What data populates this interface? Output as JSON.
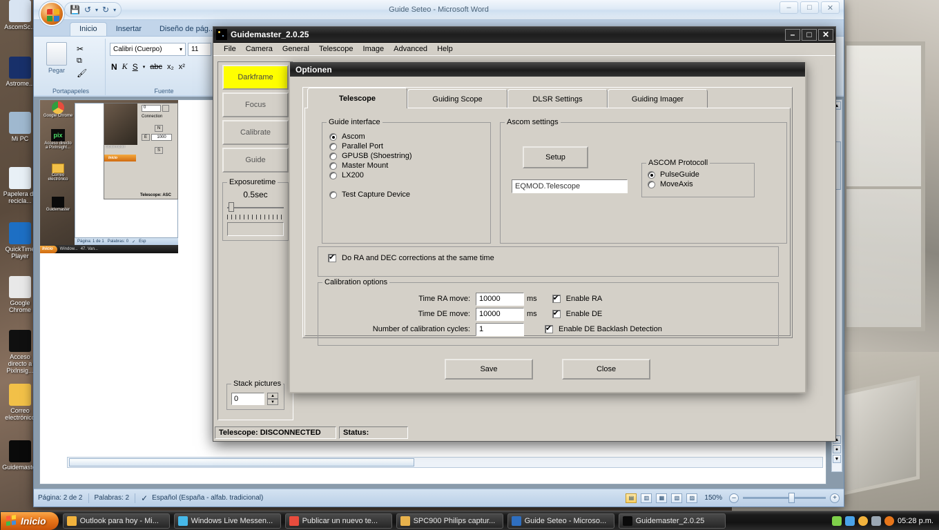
{
  "desktop": {
    "icons": [
      {
        "label": "AscomSc...",
        "color": "#d8e4f2"
      },
      {
        "label": "Astrome...",
        "color": "#18306a"
      },
      {
        "label": "Mi PC",
        "color": "#9fb8cf"
      },
      {
        "label": "Papelera de recicla...",
        "color": "#e8f0f6"
      },
      {
        "label": "QuickTime Player",
        "color": "#1d6fc4"
      },
      {
        "label": "Google Chrome",
        "color": "#e8e8e8"
      },
      {
        "label": "Acceso directo a PixInsig...",
        "color": "#101010"
      },
      {
        "label": "Correo electrónico",
        "color": "#f2c048"
      },
      {
        "label": "Guidemaster",
        "color": "#0a0a0a"
      }
    ]
  },
  "word": {
    "title": "Guide Seteo - Microsoft Word",
    "window_controls": [
      "–",
      "□",
      "✕"
    ],
    "quick_access": [
      "save-icon",
      "undo-icon",
      "redo-icon",
      "customize-icon"
    ],
    "tabs": [
      {
        "label": "Inicio",
        "active": true
      },
      {
        "label": "Insertar",
        "active": false
      },
      {
        "label": "Diseño de pág...",
        "active": false
      }
    ],
    "ribbon": {
      "clipboard_group_label": "Portapapeles",
      "paste_label": "Pegar",
      "font_group_label": "Fuente",
      "font_name": "Calibri (Cuerpo)",
      "font_size": "11",
      "font_buttons": [
        "N",
        "K",
        "S",
        "abc",
        "x₂",
        "x²"
      ]
    },
    "status": {
      "page": "Página: 2 de 2",
      "words": "Palabras: 2",
      "proofing_icon": "spellcheck-icon",
      "language": "Español (España - alfab. tradicional)",
      "zoom": "150%",
      "zoom_out": "–",
      "zoom_in": "+",
      "view_buttons": [
        "print-layout",
        "full-screen-reading",
        "web-layout",
        "outline",
        "draft"
      ]
    },
    "embedded_image": {
      "icons": [
        {
          "label": "Google Chrome"
        },
        {
          "label": "Acceso directo a PixInsight..."
        },
        {
          "label": "Correo electrónico"
        },
        {
          "label": "Guidemaster"
        }
      ],
      "panel": {
        "stack_value": "0",
        "connection_label": "Connection",
        "north_label": "N",
        "east_label": "E",
        "rate_value": "1000",
        "south_label": "S",
        "telescope_status": "Telescope: ASC"
      },
      "status": {
        "page": "Página: 1 de 1",
        "words": "Palabras: 0",
        "language": "Esp"
      },
      "taskbar": {
        "start": "Inicio",
        "buttons": [
          "Window...",
          "47. Van..."
        ]
      }
    }
  },
  "guidemaster": {
    "title": "Guidemaster_2.0.25",
    "window_controls": [
      "–",
      "□",
      "✕"
    ],
    "menu": [
      "File",
      "Camera",
      "General",
      "Telescope",
      "Image",
      "Advanced",
      "Help"
    ],
    "buttons": [
      {
        "label": "Darkframe",
        "highlighted": true
      },
      {
        "label": "Focus",
        "highlighted": false
      },
      {
        "label": "Calibrate",
        "highlighted": false
      },
      {
        "label": "Guide",
        "highlighted": false
      }
    ],
    "exposure": {
      "group_label": "Exposuretime",
      "value": "0.5sec"
    },
    "stack": {
      "group_label": "Stack pictures",
      "value": "0"
    },
    "status": {
      "telescope": "Telescope: DISCONNECTED",
      "status_label": "Status:"
    }
  },
  "optionen": {
    "title": "Optionen",
    "tabs": [
      {
        "label": "Telescope",
        "active": true
      },
      {
        "label": "Guiding Scope",
        "active": false
      },
      {
        "label": "DLSR Settings",
        "active": false
      },
      {
        "label": "Guiding Imager",
        "active": false
      }
    ],
    "guide_interface": {
      "group_label": "Guide interface",
      "options": [
        {
          "label": "Ascom",
          "selected": true
        },
        {
          "label": "Parallel Port",
          "selected": false
        },
        {
          "label": "GPUSB (Shoestring)",
          "selected": false
        },
        {
          "label": "Master Mount",
          "selected": false
        },
        {
          "label": "LX200",
          "selected": false
        },
        {
          "label": "Test Capture Device",
          "selected": false
        }
      ]
    },
    "ascom_settings": {
      "group_label": "Ascom settings",
      "setup_button": "Setup",
      "driver_value": "EQMOD.Telescope",
      "protocol": {
        "group_label": "ASCOM Protocoll",
        "options": [
          {
            "label": "PulseGuide",
            "selected": true
          },
          {
            "label": "MoveAxis",
            "selected": false
          }
        ]
      }
    },
    "simultaneous": {
      "label": "Do RA and DEC corrections at the same time",
      "checked": true
    },
    "calibration": {
      "group_label": "Calibration options",
      "rows": [
        {
          "label": "Time RA move:",
          "value": "10000",
          "unit": "ms"
        },
        {
          "label": "Time DE move:",
          "value": "10000",
          "unit": "ms"
        },
        {
          "label": "Number of calibration cycles:",
          "value": "1",
          "unit": ""
        }
      ],
      "checks": [
        {
          "label": "Enable RA",
          "checked": true
        },
        {
          "label": "Enable DE",
          "checked": true
        },
        {
          "label": "Enable DE Backlash Detection",
          "checked": true
        }
      ]
    },
    "footer": {
      "save": "Save",
      "close": "Close"
    }
  },
  "taskbar": {
    "start_label": "Inicio",
    "buttons": [
      {
        "label": "Outlook para hoy - Mi...",
        "color": "#f2b33d"
      },
      {
        "label": "Windows Live Messen...",
        "color": "#46b8e8"
      },
      {
        "label": "Publicar un nuevo te...",
        "color": "#e84c3d"
      },
      {
        "label": "SPC900 Philips captur...",
        "color": "#e8b24c"
      },
      {
        "label": "Guide Seteo - Microso...",
        "color": "#2f6fc0"
      },
      {
        "label": "Guidemaster_2.0.25",
        "color": "#0a0a0a"
      }
    ],
    "tray_icons": [
      "battery-icon",
      "network-icon",
      "shield-icon",
      "bluetooth-icon",
      "firefox-icon"
    ],
    "clock": "05:28 p.m."
  }
}
